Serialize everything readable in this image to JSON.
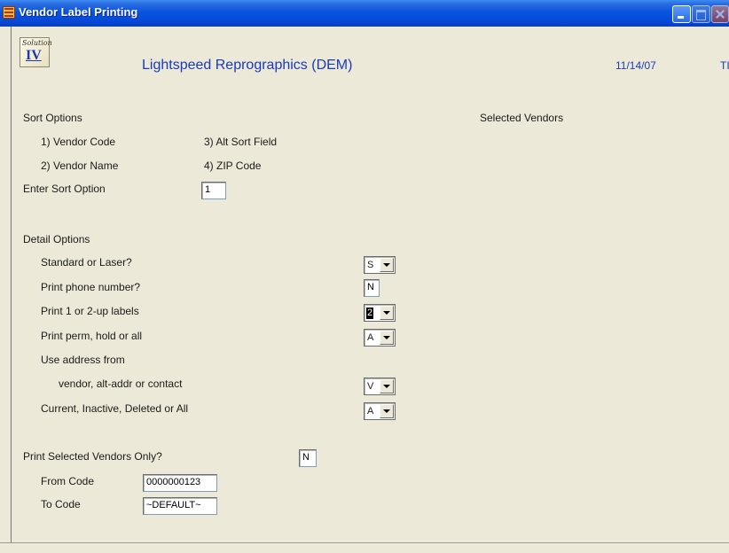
{
  "window": {
    "title": "Vendor Label Printing"
  },
  "header": {
    "logo_line1": "Solution",
    "logo_line2": "IV",
    "company": "Lightspeed Reprographics (DEM)",
    "date": "11/14/07",
    "terminal": "TI"
  },
  "sort": {
    "heading": "Sort Options",
    "opt1": "1) Vendor Code",
    "opt2": "2) Vendor Name",
    "opt3": "3) Alt Sort Field",
    "opt4": "4) ZIP Code",
    "enter_label": "Enter Sort Option",
    "enter_value": "1"
  },
  "selected_vendors": {
    "heading": "Selected Vendors"
  },
  "detail": {
    "heading": "Detail Options",
    "standard_laser": {
      "label": "Standard or Laser?",
      "value": "S"
    },
    "phone": {
      "label": "Print phone number?",
      "value": "N"
    },
    "up_labels": {
      "label": "Print 1 or 2-up labels",
      "value": "2"
    },
    "perm_hold": {
      "label": "Print perm, hold or all",
      "value": "A"
    },
    "use_address": {
      "label": "Use address from",
      "sublabel": "vendor, alt-addr or contact",
      "value": "V"
    },
    "status": {
      "label": "Current, Inactive, Deleted or All",
      "value": "A"
    }
  },
  "selection": {
    "label": "Print Selected Vendors Only?",
    "value": "N",
    "from_label": "From Code",
    "from_value": "0000000123",
    "to_label": "To Code",
    "to_value": "~DEFAULT~"
  }
}
